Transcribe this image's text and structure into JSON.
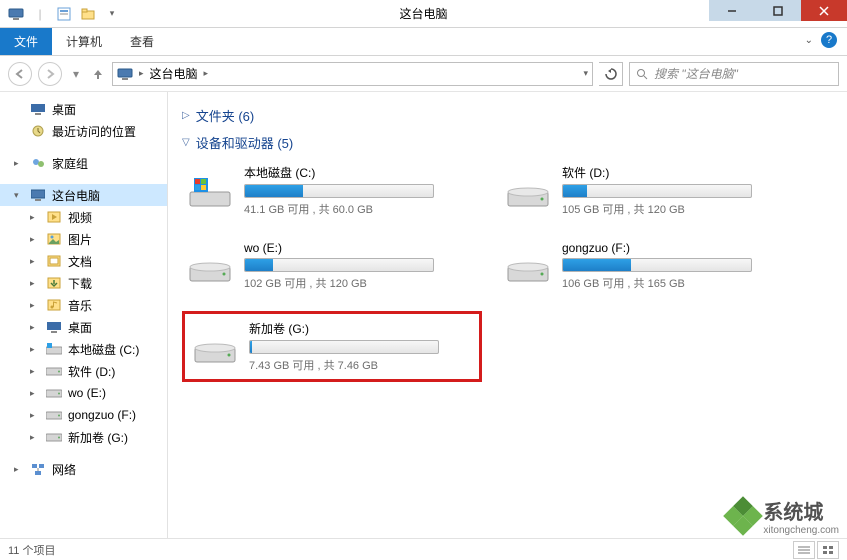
{
  "window": {
    "title": "这台电脑"
  },
  "ribbon": {
    "file": "文件",
    "computer": "计算机",
    "view": "查看"
  },
  "nav": {
    "location": "这台电脑",
    "search_placeholder": "搜索 \"这台电脑\""
  },
  "sidebar": {
    "favorites": [
      {
        "label": "桌面",
        "icon": "desktop"
      },
      {
        "label": "最近访问的位置",
        "icon": "recent"
      }
    ],
    "homegroup": "家庭组",
    "this_pc": "这台电脑",
    "this_pc_children": [
      {
        "label": "视频",
        "icon": "video"
      },
      {
        "label": "图片",
        "icon": "pictures"
      },
      {
        "label": "文档",
        "icon": "documents"
      },
      {
        "label": "下载",
        "icon": "downloads"
      },
      {
        "label": "音乐",
        "icon": "music"
      },
      {
        "label": "桌面",
        "icon": "desktop"
      },
      {
        "label": "本地磁盘 (C:)",
        "icon": "drive-os"
      },
      {
        "label": "软件 (D:)",
        "icon": "drive"
      },
      {
        "label": "wo (E:)",
        "icon": "drive"
      },
      {
        "label": "gongzuo (F:)",
        "icon": "drive"
      },
      {
        "label": "新加卷 (G:)",
        "icon": "drive"
      }
    ],
    "network": "网络"
  },
  "sections": {
    "folders": "文件夹 (6)",
    "devices": "设备和驱动器 (5)"
  },
  "drives": [
    {
      "name": "本地磁盘 (C:)",
      "meta": "41.1 GB 可用 , 共 60.0 GB",
      "fill_pct": 31,
      "os": true
    },
    {
      "name": "软件 (D:)",
      "meta": "105 GB 可用 , 共 120 GB",
      "fill_pct": 13,
      "os": false
    },
    {
      "name": "wo (E:)",
      "meta": "102 GB 可用 , 共 120 GB",
      "fill_pct": 15,
      "os": false
    },
    {
      "name": "gongzuo (F:)",
      "meta": "106 GB 可用 , 共 165 GB",
      "fill_pct": 36,
      "os": false
    },
    {
      "name": "新加卷 (G:)",
      "meta": "7.43 GB 可用 , 共 7.46 GB",
      "fill_pct": 1,
      "os": false,
      "highlighted": true
    }
  ],
  "status": {
    "items": "11 个项目"
  },
  "watermark": {
    "text": "系统城",
    "sub": "xitongcheng.com"
  }
}
